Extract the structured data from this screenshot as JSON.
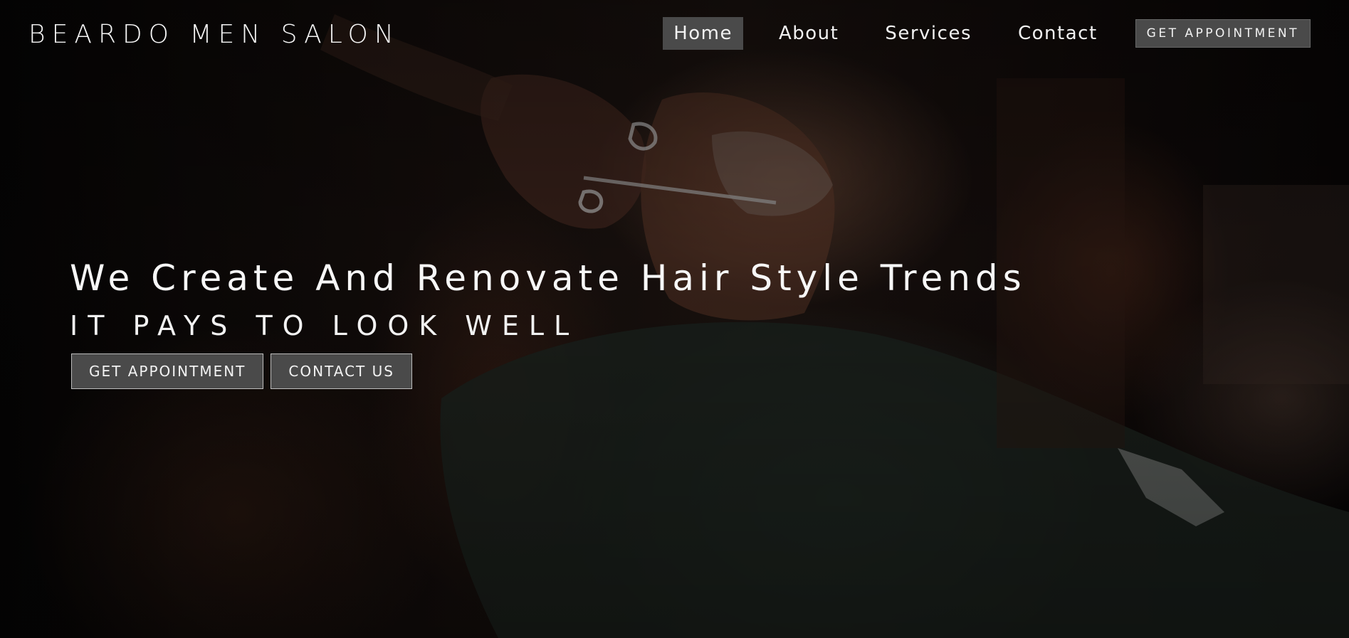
{
  "header": {
    "brand": "BEARDO MEN SALON",
    "nav": [
      {
        "label": "Home",
        "active": true
      },
      {
        "label": "About",
        "active": false
      },
      {
        "label": "Services",
        "active": false
      },
      {
        "label": "Contact",
        "active": false
      }
    ],
    "cta_label": "GET APPOINTMENT"
  },
  "hero": {
    "title": "We Create And Renovate Hair Style Trends",
    "subtitle": "IT PAYS TO LOOK WELL",
    "buttons": {
      "appointment_label": "GET APPOINTMENT",
      "contact_label": "CONTACT US"
    },
    "background_image": "barber-trimming-beard-photo"
  },
  "colors": {
    "nav_active_bg": "#4a4a4a",
    "button_bg": "#4a4a4a",
    "text": "#f4f4f4"
  }
}
